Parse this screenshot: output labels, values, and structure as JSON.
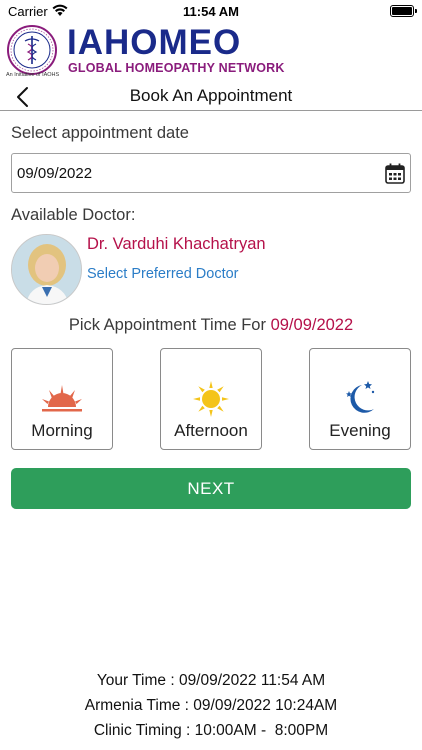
{
  "status_bar": {
    "carrier": "Carrier",
    "time": "11:54 AM"
  },
  "brand": {
    "title": "IAHOMEO",
    "subtitle": "GLOBAL HOMEOPATHY NETWORK",
    "seal_caption": "An Initiative of IAOHS",
    "title_color": "#1a2a8a",
    "subtitle_color": "#8a1c7c"
  },
  "nav": {
    "title": "Book An Appointment"
  },
  "date_section": {
    "label": "Select appointment date",
    "value": "09/09/2022"
  },
  "doctor_section": {
    "label": "Available Doctor:",
    "name": "Dr. Varduhi Khachatryan",
    "select_link": "Select Preferred Doctor"
  },
  "time_section": {
    "prompt": "Pick Appointment Time For",
    "date": "09/09/2022",
    "slots": [
      {
        "label": "Morning",
        "icon": "sunrise-icon"
      },
      {
        "label": "Afternoon",
        "icon": "sun-icon"
      },
      {
        "label": "Evening",
        "icon": "moon-stars-icon"
      }
    ]
  },
  "next_button": "NEXT",
  "footer": {
    "your_time": "Your Time : 09/09/2022 11:54 AM",
    "armenia_time": "Armenia Time : 09/09/2022 10:24AM",
    "clinic_timing": "Clinic Timing : 10:00AM -  8:00PM"
  },
  "colors": {
    "accent_red": "#b5114a",
    "link_blue": "#2b7dc7",
    "button_green": "#2e9e5b"
  }
}
